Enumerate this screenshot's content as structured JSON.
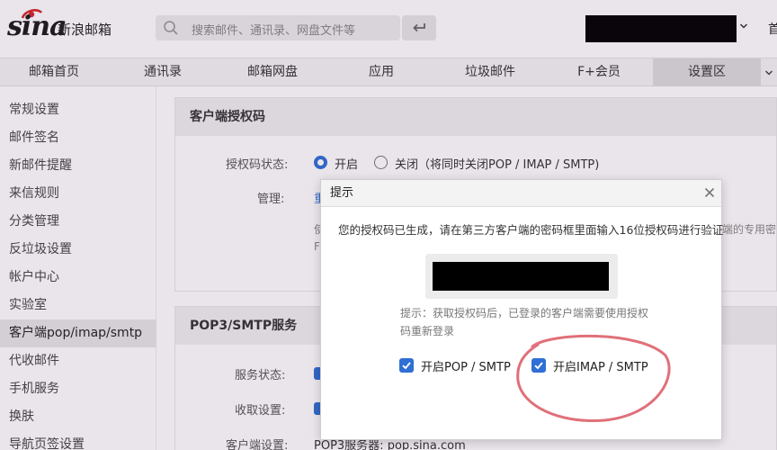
{
  "header": {
    "logo_text": "sina",
    "logo_cn": "新浪邮箱",
    "search_placeholder": "搜索邮件、通讯录、网盘文件等",
    "home_link": "首"
  },
  "nav": {
    "tabs": [
      {
        "label": "邮箱首页"
      },
      {
        "label": "通讯录"
      },
      {
        "label": "邮箱网盘"
      },
      {
        "label": "应用"
      },
      {
        "label": "垃圾邮件"
      },
      {
        "label": "F+会员"
      },
      {
        "label": "设置区",
        "active": true
      }
    ]
  },
  "sidebar": {
    "items": [
      {
        "label": "常规设置"
      },
      {
        "label": "邮件签名"
      },
      {
        "label": "新邮件提醒"
      },
      {
        "label": "来信规则"
      },
      {
        "label": "分类管理"
      },
      {
        "label": "反垃圾设置"
      },
      {
        "label": "帐户中心"
      },
      {
        "label": "实验室"
      },
      {
        "label": "客户端pop/imap/smtp",
        "active": true
      },
      {
        "label": "代收邮件"
      },
      {
        "label": "手机服务"
      },
      {
        "label": "换肤"
      },
      {
        "label": "导航页签设置"
      }
    ]
  },
  "auth_section": {
    "title": "客户端授权码",
    "status_label": "授权码状态:",
    "option_on": "开启",
    "option_off": "关闭（将同时关闭POP / IMAP / SMTP)",
    "manage_label": "管理:",
    "manage_link_fragment": "重",
    "faint_fragment_1": "使",
    "faint_fragment_2": "F",
    "faint_right_fragment": "端的专用密"
  },
  "pop_section": {
    "title": "POP3/SMTP服务",
    "service_status_label": "服务状态:",
    "receive_label": "收取设置:",
    "client_label": "客户端设置:",
    "client_value": "POP3服务器: pop.sina.com"
  },
  "modal": {
    "title": "提示",
    "message": "您的授权码已生成，请在第三方客户端的密码框里面输入16位授权码进行验证",
    "hint": "提示：获取授权码后，已登录的客户端需要使用授权码重新登录",
    "options": [
      {
        "label": "开启POP / SMTP",
        "checked": true
      },
      {
        "label": "开启IMAP / SMTP",
        "checked": true
      }
    ]
  },
  "colors": {
    "accent": "#2f6fd6",
    "annotation": "#e0707a",
    "nav_active": "#dcdcdc"
  }
}
